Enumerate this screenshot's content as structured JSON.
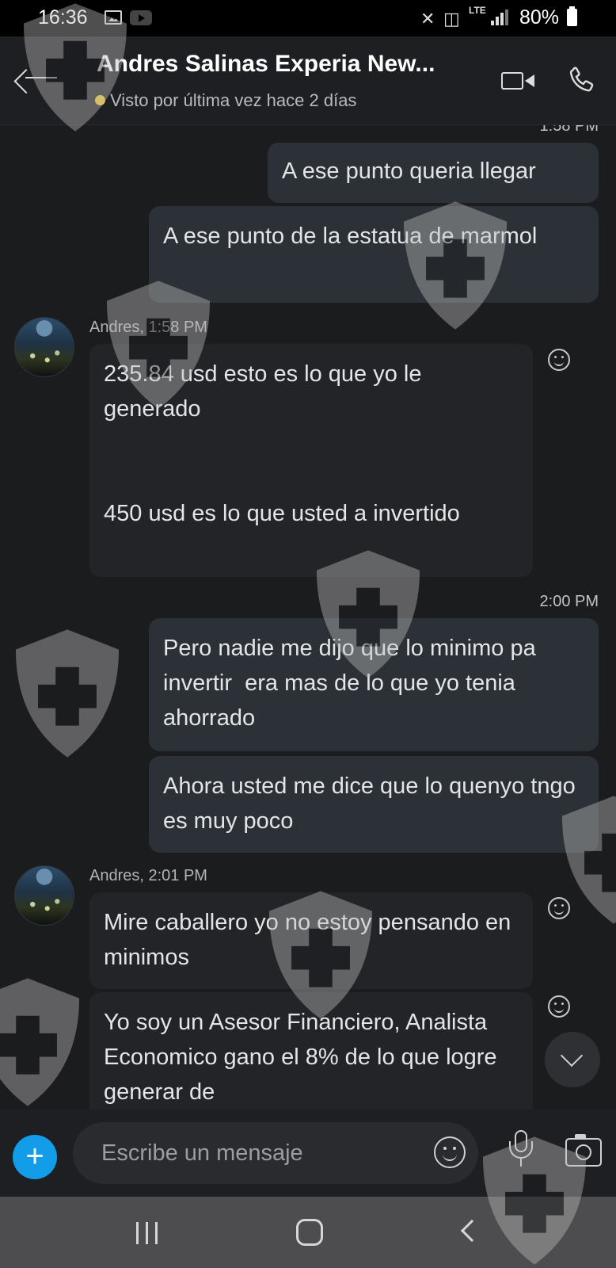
{
  "status_bar": {
    "time": "16:36",
    "network": "LTE",
    "battery": "80%"
  },
  "header": {
    "contact_name": "Andres Salinas Experia New...",
    "presence": "Visto por última vez hace 2 días",
    "presence_color": "#e8c234"
  },
  "messages": {
    "top_partial_time": "1:58 PM",
    "out1": "A ese punto queria llegar",
    "out2": "A ese punto de la estatua de marmol",
    "sender1": "Andres, 1:58 PM",
    "in1": "235.84 usd esto es lo que yo le generado\n\n\n450 usd es lo que usted a invertido",
    "time2": "2:00 PM",
    "out3": "Pero nadie me dijo que lo minimo pa invertir  era mas de lo que yo tenia ahorrado",
    "out4": "Ahora usted me dice que lo quenyo tngo es muy poco",
    "sender2": "Andres, 2:01 PM",
    "in2": "Mire caballero yo no estoy pensando en minimos",
    "in3": "Yo soy un Asesor Financiero, Analista Economico gano el 8% de lo que logre generar de"
  },
  "compose": {
    "placeholder": "Escribe un mensaje",
    "accent": "#139de8"
  },
  "icons": {
    "back": "arrow-left-icon",
    "video": "video-camera-icon",
    "call": "phone-icon",
    "react": "smiley-icon",
    "scroll": "chevron-down-icon",
    "add": "plus-icon",
    "emoji": "emoji-icon",
    "mic": "microphone-icon",
    "camera": "camera-icon"
  }
}
